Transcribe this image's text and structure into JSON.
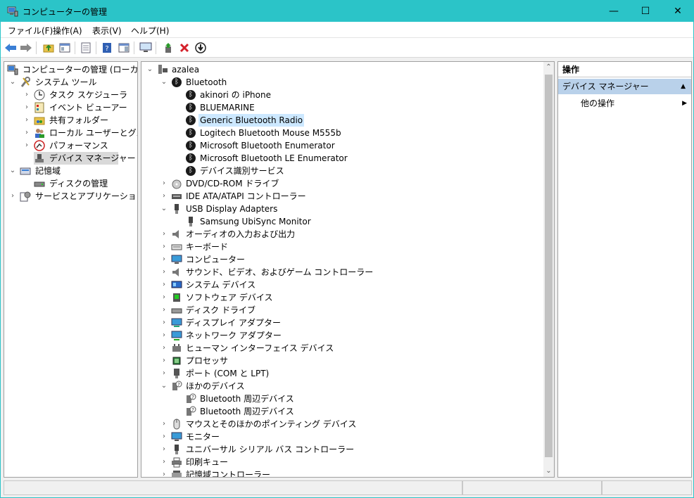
{
  "window": {
    "title": "コンピューターの管理",
    "minimize": "—",
    "maximize": "☐",
    "close": "✕"
  },
  "menu": [
    "ファイル(F)",
    "操作(A)",
    "表示(V)",
    "ヘルプ(H)"
  ],
  "left_tree": [
    {
      "label": "コンピューターの管理 (ローカル)",
      "icon": "computer-management-icon"
    },
    {
      "label": "システム ツール",
      "icon": "tools-icon"
    },
    {
      "label": "タスク スケジューラ",
      "icon": "clock-icon"
    },
    {
      "label": "イベント ビューアー",
      "icon": "event-viewer-icon"
    },
    {
      "label": "共有フォルダー",
      "icon": "shared-folder-icon"
    },
    {
      "label": "ローカル ユーザーとグループ",
      "icon": "users-icon"
    },
    {
      "label": "パフォーマンス",
      "icon": "performance-icon"
    },
    {
      "label": "デバイス マネージャー",
      "icon": "device-manager-icon"
    },
    {
      "label": "記憶域",
      "icon": "storage-icon"
    },
    {
      "label": "ディスクの管理",
      "icon": "disk-management-icon"
    },
    {
      "label": "サービスとアプリケーション",
      "icon": "services-icon"
    }
  ],
  "device_tree": [
    {
      "label": "azalea",
      "icon": "computer-icon"
    },
    {
      "label": "Bluetooth",
      "icon": "bluetooth-icon"
    },
    {
      "label": "akinori の iPhone",
      "icon": "bluetooth-icon"
    },
    {
      "label": "BLUEMARINE",
      "icon": "bluetooth-icon"
    },
    {
      "label": "Generic Bluetooth Radio",
      "icon": "bluetooth-icon"
    },
    {
      "label": "Logitech Bluetooth Mouse M555b",
      "icon": "bluetooth-icon"
    },
    {
      "label": "Microsoft Bluetooth Enumerator",
      "icon": "bluetooth-icon"
    },
    {
      "label": "Microsoft Bluetooth LE Enumerator",
      "icon": "bluetooth-icon"
    },
    {
      "label": "デバイス識別サービス",
      "icon": "bluetooth-icon"
    },
    {
      "label": "DVD/CD-ROM ドライブ",
      "icon": "dvd-icon"
    },
    {
      "label": "IDE ATA/ATAPI コントローラー",
      "icon": "ide-controller-icon"
    },
    {
      "label": "USB Display Adapters",
      "icon": "usb-icon"
    },
    {
      "label": "Samsung UbiSync Monitor",
      "icon": "usb-icon"
    },
    {
      "label": "オーディオの入力および出力",
      "icon": "speaker-icon"
    },
    {
      "label": "キーボード",
      "icon": "keyboard-icon"
    },
    {
      "label": "コンピューター",
      "icon": "monitor-icon"
    },
    {
      "label": "サウンド、ビデオ、およびゲーム コントローラー",
      "icon": "speaker-icon"
    },
    {
      "label": "システム デバイス",
      "icon": "system-device-icon"
    },
    {
      "label": "ソフトウェア デバイス",
      "icon": "software-device-icon"
    },
    {
      "label": "ディスク ドライブ",
      "icon": "disk-drive-icon"
    },
    {
      "label": "ディスプレイ アダプター",
      "icon": "display-adapter-icon"
    },
    {
      "label": "ネットワーク アダプター",
      "icon": "network-adapter-icon"
    },
    {
      "label": "ヒューマン インターフェイス デバイス",
      "icon": "hid-icon"
    },
    {
      "label": "プロセッサ",
      "icon": "processor-icon"
    },
    {
      "label": "ポート (COM と LPT)",
      "icon": "port-icon"
    },
    {
      "label": "ほかのデバイス",
      "icon": "unknown-device-icon"
    },
    {
      "label": "Bluetooth 周辺デバイス",
      "icon": "unknown-device-icon"
    },
    {
      "label": "Bluetooth 周辺デバイス",
      "icon": "unknown-device-icon"
    },
    {
      "label": "マウスとそのほかのポインティング デバイス",
      "icon": "mouse-icon"
    },
    {
      "label": "モニター",
      "icon": "monitor-icon"
    },
    {
      "label": "ユニバーサル シリアル バス コントローラー",
      "icon": "usb-icon"
    },
    {
      "label": "印刷キュー",
      "icon": "printer-icon"
    },
    {
      "label": "記憶域コントローラー",
      "icon": "storage-controller-icon"
    }
  ],
  "actions": {
    "header": "操作",
    "section": "デバイス マネージャー",
    "other": "他の操作"
  },
  "colors": {
    "titlebar": "#2bc4c8",
    "selection": "#cce8ff",
    "action_section": "#b9d1ea"
  }
}
